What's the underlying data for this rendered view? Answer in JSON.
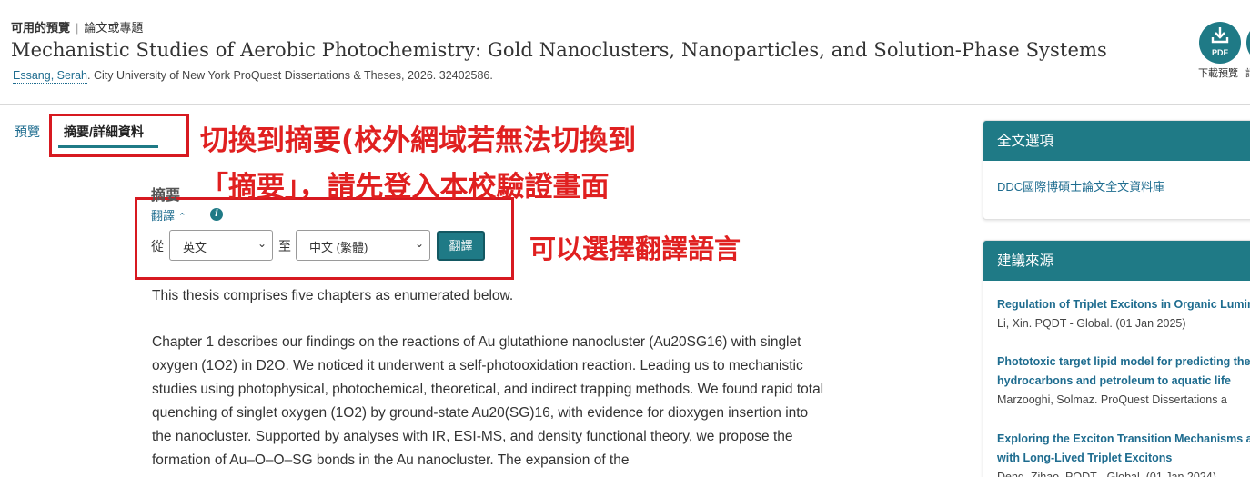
{
  "header": {
    "availability": "可用的預覽",
    "doc_type": "論文或專題",
    "title": "Mechanistic Studies of Aerobic Photochemistry: Gold Nanoclusters, Nanoparticles, and Solution-Phase Systems",
    "author": "Essang, Serah",
    "citation_rest": ".  City University of New York ProQuest Dissertations & Theses,  2026. 32402586.",
    "pdf_icon_text": "PDF",
    "pdf_label": "下載預覽",
    "next_label": "請"
  },
  "tabs": {
    "preview": "預覽",
    "abstract": "摘要/詳細資料"
  },
  "annotations": {
    "line1": "切換到摘要(校外網域若無法切換到",
    "line2": "「摘要」，請先登入本校驗證畫面",
    "line3": "可以選擇翻譯語言"
  },
  "abstract": {
    "heading": "摘要",
    "translate_toggle": "翻譯",
    "info_icon_glyph": "i",
    "from_label": "從",
    "to_label": "至",
    "from_value": "英文",
    "to_value": "中文 (繁體)",
    "translate_button": "翻譯",
    "para1": "This thesis comprises five chapters as enumerated below.",
    "para2": "Chapter 1 describes our findings on the reactions of Au glutathione nanocluster (Au20SG16) with singlet oxygen (1O2) in D2O. We noticed it underwent a self-photooxidation reaction. Leading us to mechanistic studies using photophysical, photochemical, theoretical, and indirect trapping methods. We found rapid total quenching of singlet oxygen (1O2) by ground-state Au20(SG)16, with evidence for dioxygen insertion into the nanocluster. Supported by analyses with IR, ESI-MS, and density functional theory, we propose the formation of Au–O–O–SG bonds in the Au nanocluster. The expansion of the"
  },
  "sidebar": {
    "fulltext_title": "全文選項",
    "fulltext_link": "DDC國際博碩士論文全文資料庫",
    "suggest_title": "建議來源",
    "items": [
      {
        "title": "Regulation of Triplet Excitons in Organic Lumin",
        "meta": "Li, Xin.  PQDT - Global. (01 Jan 2025)"
      },
      {
        "title": "Phototoxic target lipid model for predicting the",
        "title2": "hydrocarbons and petroleum to aquatic life",
        "meta": "Marzooghi, Solmaz.  ProQuest Dissertations a"
      },
      {
        "title": "Exploring the Exciton Transition Mechanisms ar",
        "title2": "with Long-Lived Triplet Excitons",
        "meta": "Deng, Zihao.  PQDT - Global. (01 Jan 2024)"
      }
    ]
  },
  "colors": {
    "accent": "#1f7a86",
    "link": "#1e6c8f",
    "annotation_red": "#e02020"
  }
}
